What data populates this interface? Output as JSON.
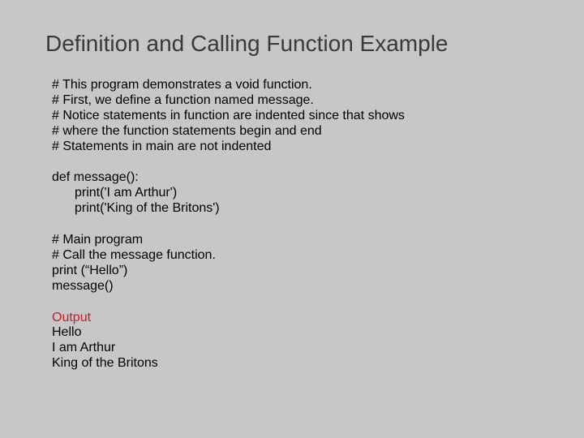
{
  "title": "Definition and Calling Function Example",
  "comments": {
    "c1": "# This program demonstrates a void function.",
    "c2": "# First, we define a function named message.",
    "c3": "# Notice statements in function are indented since that shows",
    "c4": "# where the function statements begin and end",
    "c5": "# Statements in main are not indented"
  },
  "func": {
    "defline": "def message():",
    "body1": "print('I am Arthur')",
    "body2": "print('King of the Britons')"
  },
  "main": {
    "c1": "# Main program",
    "c2": "# Call the message function.",
    "s1": "print (“Hello”)",
    "s2": "message()"
  },
  "output": {
    "label": "Output",
    "l1": "Hello",
    "l2": "I am Arthur",
    "l3": "King of the Britons"
  }
}
